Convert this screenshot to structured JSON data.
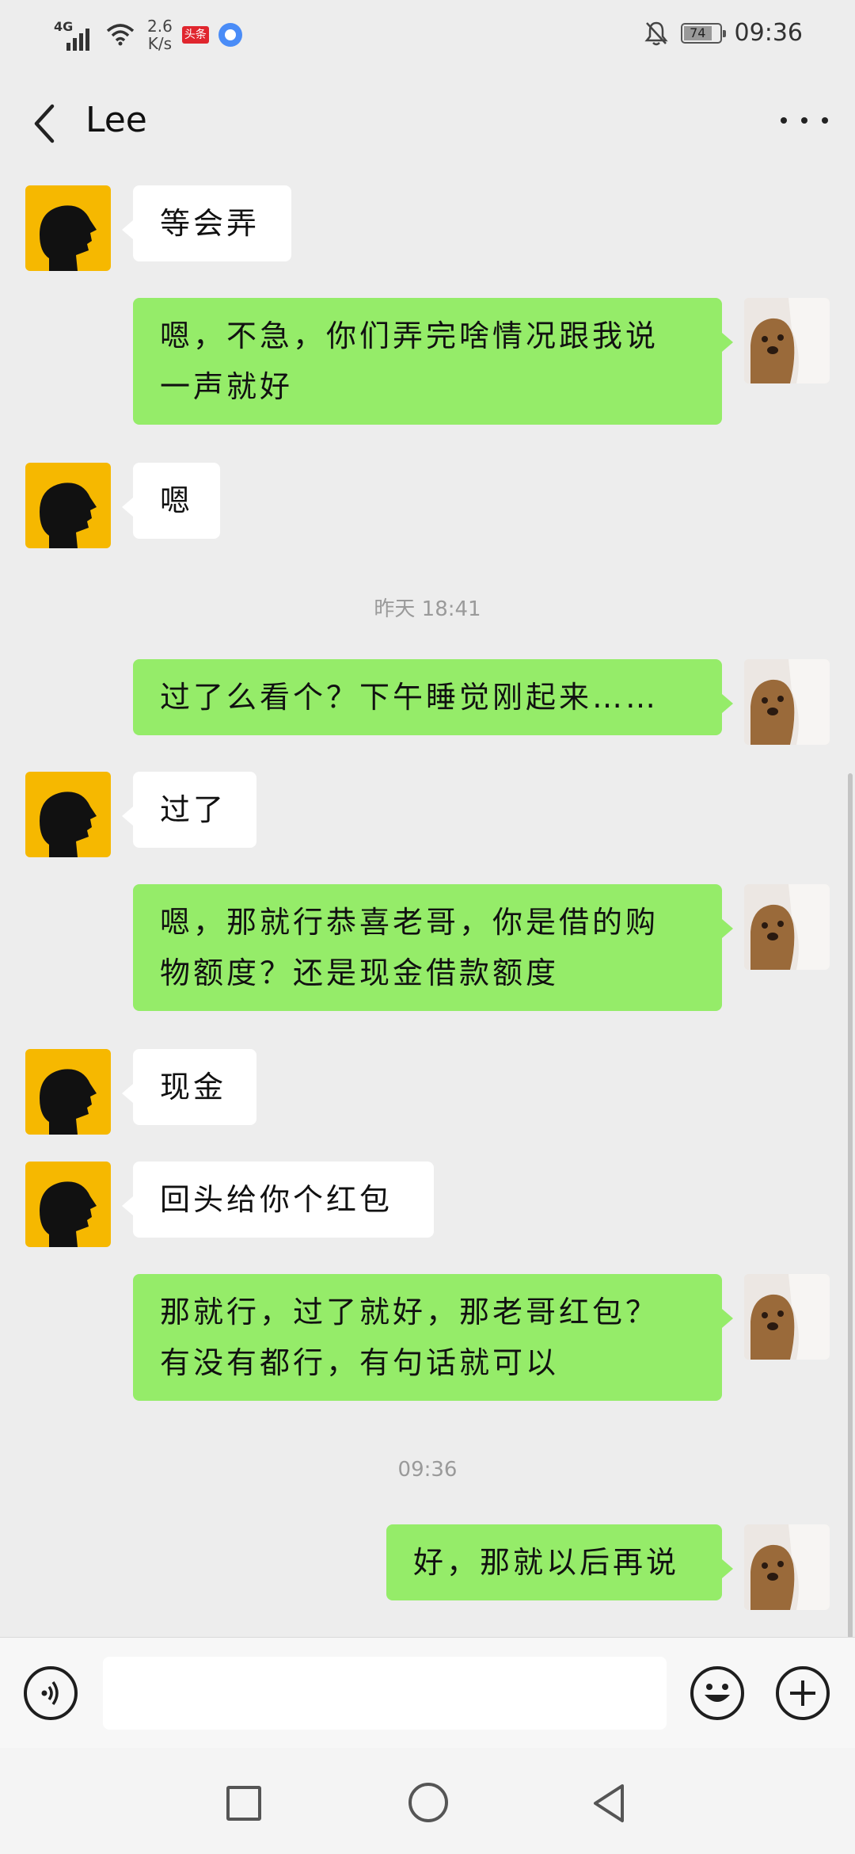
{
  "status_bar": {
    "network": "4G",
    "speed_value": "2.6",
    "speed_unit": "K/s",
    "app_badge": "头条",
    "battery": "74",
    "time": "09:36"
  },
  "header": {
    "title": "Lee"
  },
  "messages": [
    {
      "id": "m1",
      "text": "等会弄"
    },
    {
      "id": "m2",
      "text_line1": "嗯，不急，你们弄完啥情况跟我说",
      "text_line2": "一声就好"
    },
    {
      "id": "m3",
      "text": "嗯"
    },
    {
      "id": "ts1",
      "text": "昨天 18:41"
    },
    {
      "id": "m4",
      "text": "过了么看个？下午睡觉刚起来……"
    },
    {
      "id": "m5",
      "text": "过了"
    },
    {
      "id": "m6",
      "text_line1": "嗯，那就行恭喜老哥，你是借的购",
      "text_line2": "物额度？还是现金借款额度"
    },
    {
      "id": "m7",
      "text": "现金"
    },
    {
      "id": "m8",
      "text": "回头给你个红包"
    },
    {
      "id": "m9",
      "text_line1": "那就行，过了就好，那老哥红包？",
      "text_line2": "有没有都行，有句话就可以"
    },
    {
      "id": "ts2",
      "text": "09:36"
    },
    {
      "id": "m10",
      "text": "好，那就以后再说"
    }
  ],
  "input": {
    "value": "",
    "placeholder": ""
  },
  "icons": {
    "back": "back-arrow-icon",
    "more": "more-dots-icon",
    "voice": "voice-icon",
    "emoji": "emoji-icon",
    "add": "plus-icon"
  },
  "colors": {
    "self_bubble": "#95ec69",
    "peer_bubble": "#ffffff",
    "background": "#ededed",
    "peer_avatar": "#f6b800"
  }
}
